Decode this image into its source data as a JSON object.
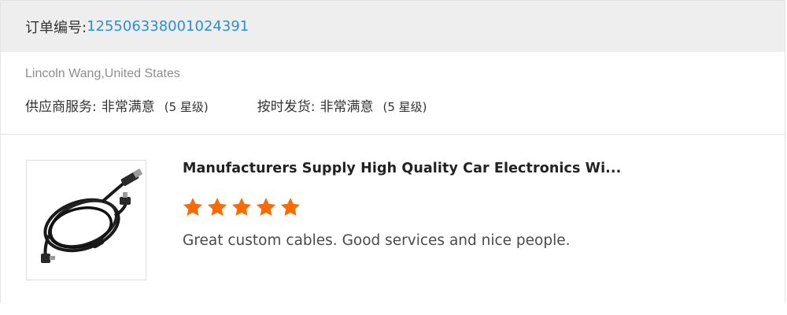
{
  "order": {
    "label": "订单编号:",
    "number": "125506338001024391"
  },
  "buyer": {
    "name": "Lincoln Wang,United States"
  },
  "ratings": [
    {
      "label": "供应商服务:",
      "value": "非常满意",
      "level": "(5 星级)",
      "stars": 5
    },
    {
      "label": "按时发货:",
      "value": "非常满意",
      "level": "(5 星级)",
      "stars": 5
    }
  ],
  "product": {
    "title": "Manufacturers Supply High Quality Car Electronics Wi...",
    "image_icon": "usb-cable-image",
    "rating_stars": 5,
    "review": "Great custom cables. Good services and nice people."
  },
  "colors": {
    "star": "#ff6a00",
    "order_number": "#2a8fd6",
    "header_bg": "#eeeeee"
  }
}
